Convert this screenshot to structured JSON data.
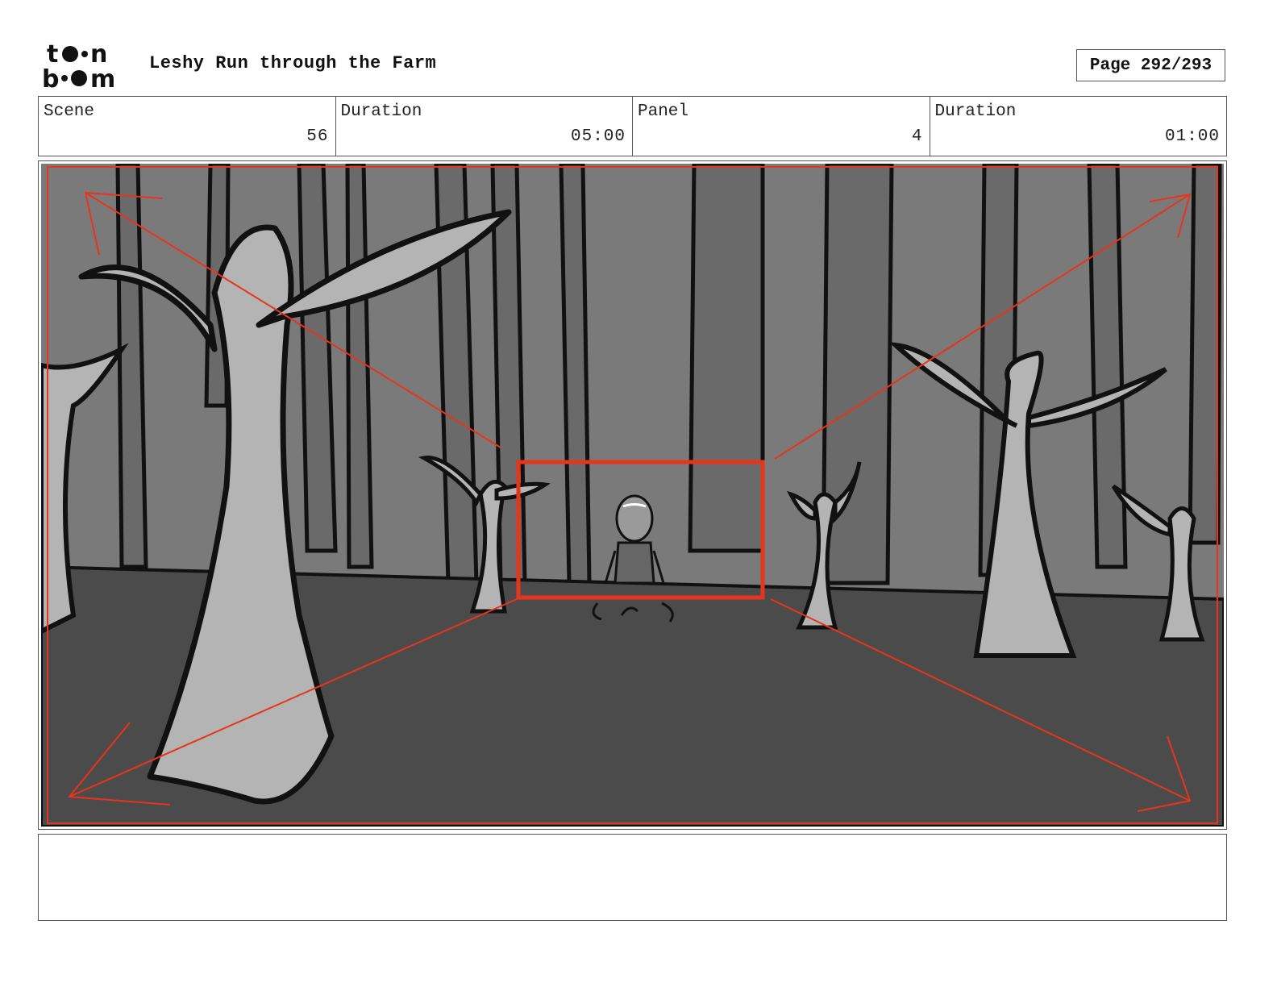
{
  "header": {
    "logo_top": "to•n",
    "logo_bottom": "b••m",
    "title": "Leshy Run through the Farm",
    "page": "Page 292/293"
  },
  "info": {
    "scene_label": "Scene",
    "scene_value": "56",
    "scene_duration_label": "Duration",
    "scene_duration_value": "05:00",
    "panel_label": "Panel",
    "panel_value": "4",
    "panel_duration_label": "Duration",
    "panel_duration_value": "01:00"
  },
  "notes": {
    "text": ""
  },
  "colors": {
    "camera_red": "#e8341c",
    "sky": "#7a7a7a",
    "ground": "#4b4b4b",
    "tree_light": "#b4b4b4"
  }
}
